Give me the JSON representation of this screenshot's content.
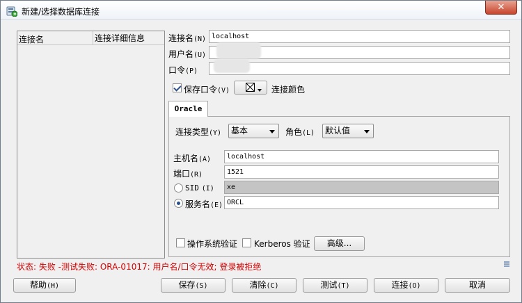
{
  "window": {
    "title": "新建/选择数据库连接"
  },
  "list": {
    "col_name": "连接名",
    "col_detail": "连接详细信息"
  },
  "form": {
    "conn_name_label": "连接名",
    "conn_name_mn": "(N)",
    "conn_name_value": "localhost",
    "user_label": "用户名",
    "user_mn": "(U)",
    "user_value": "",
    "pass_label": "口令",
    "pass_mn": "(P)",
    "pass_value": "",
    "save_pass_label": "保存口令",
    "save_pass_mn": "(V)",
    "save_pass_checked": true,
    "conn_color_label": "连接颜色"
  },
  "tab": {
    "label": "Oracle",
    "conn_type_label": "连接类型",
    "conn_type_mn": "(Y)",
    "conn_type_value": "基本",
    "role_label": "角色",
    "role_mn": "(L)",
    "role_value": "默认值",
    "host_label": "主机名",
    "host_mn": "(A)",
    "host_value": "localhost",
    "port_label": "端口",
    "port_mn": "(R)",
    "port_value": "1521",
    "sid_label": "SID",
    "sid_mn": "(I)",
    "sid_value": "xe",
    "service_label": "服务名",
    "service_mn": "(E)",
    "service_value": "ORCL",
    "os_auth_label": "操作系统验证",
    "kerberos_label": "Kerberos 验证",
    "advanced_label": "高级..."
  },
  "status": {
    "text": "状态: 失败 -测试失败: ORA-01017: 用户名/口令无效; 登录被拒绝"
  },
  "buttons": {
    "help": "帮助",
    "help_mn": "(H)",
    "save": "保存",
    "save_mn": "(S)",
    "clear": "清除",
    "clear_mn": "(C)",
    "test": "测试",
    "test_mn": "(T)",
    "connect": "连接",
    "connect_mn": "(O)",
    "cancel": "取消"
  },
  "icons": {
    "app": "database-connect-icon",
    "close": "close-icon",
    "color_picker": "color-picker-icon",
    "status_detail": "list-detail-icon"
  },
  "colors": {
    "error": "#d00000",
    "accent": "#2a4f8a",
    "close": "#c8452d"
  }
}
